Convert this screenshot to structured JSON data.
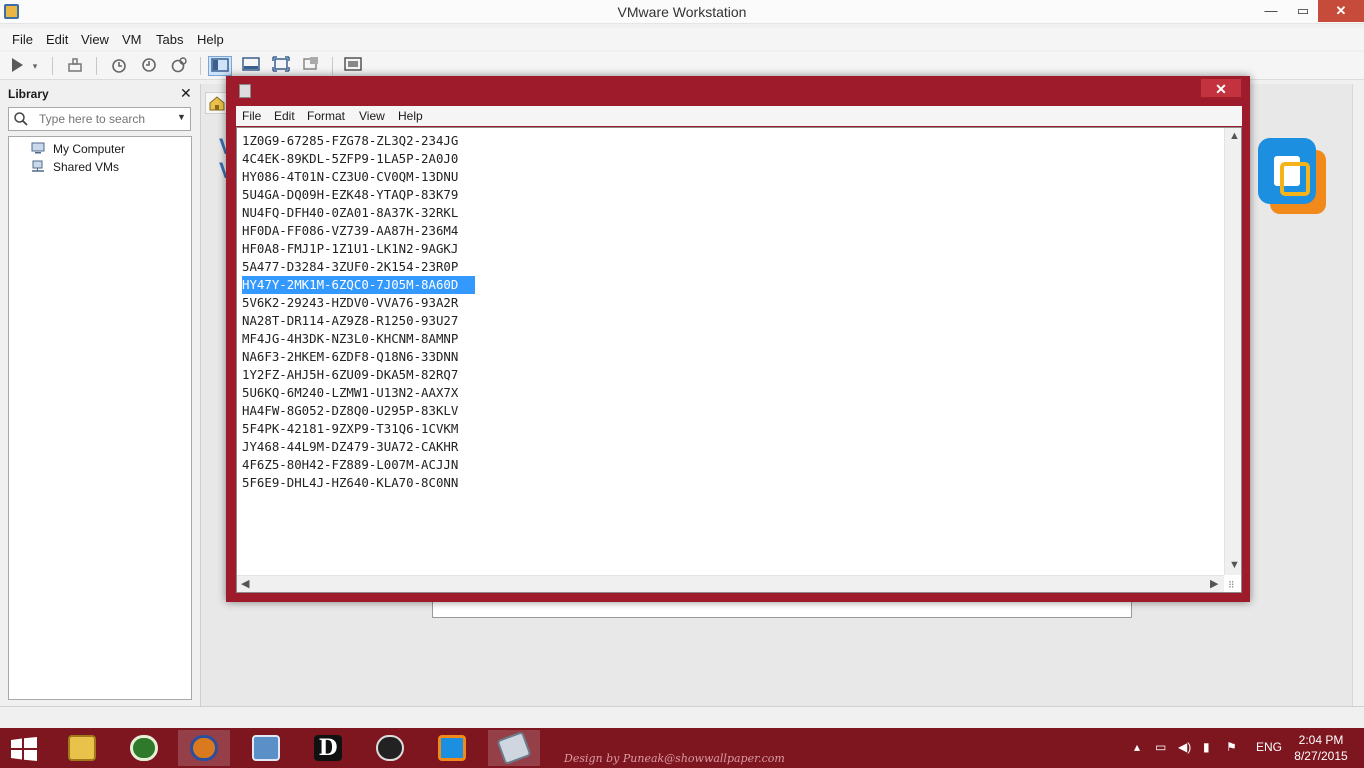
{
  "app": {
    "title": "VMware Workstation"
  },
  "window_controls": {
    "minimize": "—",
    "maximize": "▭",
    "close": "✕"
  },
  "menu": [
    "File",
    "Edit",
    "View",
    "VM",
    "Tabs",
    "Help"
  ],
  "library": {
    "title": "Library",
    "close": "✕",
    "search_placeholder": "Type here to search",
    "tree": [
      "My Computer",
      "Shared VMs"
    ]
  },
  "notepad": {
    "close": "✕",
    "menu": [
      "File",
      "Edit",
      "Format",
      "View",
      "Help"
    ],
    "lines": [
      "1Z0G9-67285-FZG78-ZL3Q2-234JG",
      "4C4EK-89KDL-5ZFP9-1LA5P-2A0J0",
      "HY086-4T01N-CZ3U0-CV0QM-13DNU",
      "5U4GA-DQ09H-EZK48-YTAQP-83K79",
      "NU4FQ-DFH40-0ZA01-8A37K-32RKL",
      "HF0DA-FF086-VZ739-AA87H-236M4",
      "HF0A8-FMJ1P-1Z1U1-LK1N2-9AGKJ",
      "5A477-D3284-3ZUF0-2K154-23R0P",
      "HY47Y-2MK1M-6ZQC0-7J05M-8A60D",
      "5V6K2-29243-HZDV0-VVA76-93A2R",
      "NA28T-DR114-AZ9Z8-R1250-93U27",
      "MF4JG-4H3DK-NZ3L0-KHCNM-8AMNP",
      "NA6F3-2HKEM-6ZDF8-Q18N6-33DNN",
      "1Y2FZ-AHJ5H-6ZU09-DKA5M-82RQ7",
      "5U6KQ-6M240-LZMW1-U13N2-AAX7X",
      "HA4FW-8G052-DZ8Q0-U295P-83KLV",
      "5F4PK-42181-9ZXP9-T31Q6-1CVKM",
      "JY468-44L9M-DZ479-3UA72-CAKHR",
      "4F6Z5-80H42-FZ889-L007M-ACJJN",
      "5F6E9-DHL4J-HZ640-KLA70-8C0NN"
    ],
    "selected_line": 8
  },
  "taskbar": {
    "credit": "Design by Puneak@showwallpaper.com",
    "language": "ENG",
    "time": "2:04 PM",
    "date": "8/27/2015"
  }
}
